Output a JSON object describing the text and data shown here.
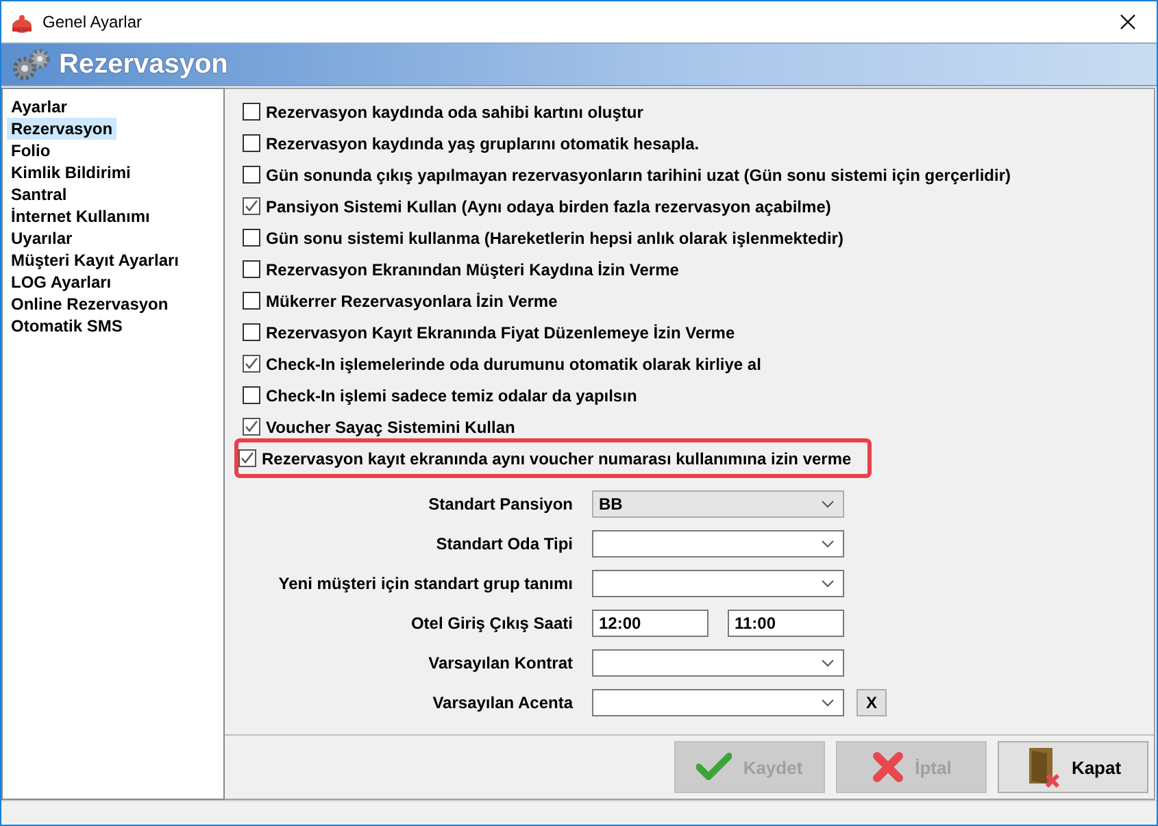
{
  "window": {
    "title": "Genel Ayarlar"
  },
  "header": {
    "title": "Rezervasyon"
  },
  "sidebar": {
    "items": [
      {
        "label": "Ayarlar",
        "selected": false
      },
      {
        "label": "Rezervasyon",
        "selected": true
      },
      {
        "label": "Folio",
        "selected": false
      },
      {
        "label": "Kimlik Bildirimi",
        "selected": false
      },
      {
        "label": "Santral",
        "selected": false
      },
      {
        "label": "İnternet Kullanımı",
        "selected": false
      },
      {
        "label": "Uyarılar",
        "selected": false
      },
      {
        "label": "Müşteri Kayıt Ayarları",
        "selected": false
      },
      {
        "label": "LOG Ayarları",
        "selected": false
      },
      {
        "label": "Online Rezervasyon",
        "selected": false
      },
      {
        "label": "Otomatik SMS",
        "selected": false
      }
    ]
  },
  "options": [
    {
      "label": "Rezervasyon kaydında oda sahibi kartını oluştur",
      "checked": false,
      "highlighted": false
    },
    {
      "label": "Rezervasyon kaydında yaş gruplarını otomatik hesapla.",
      "checked": false,
      "highlighted": false
    },
    {
      "label": "Gün sonunda çıkış yapılmayan rezervasyonların tarihini uzat (Gün sonu sistemi için gerçerlidir)",
      "checked": false,
      "highlighted": false
    },
    {
      "label": "Pansiyon Sistemi Kullan (Aynı odaya birden fazla rezervasyon açabilme)",
      "checked": true,
      "highlighted": false
    },
    {
      "label": "Gün sonu sistemi kullanma (Hareketlerin hepsi anlık olarak işlenmektedir)",
      "checked": false,
      "highlighted": false
    },
    {
      "label": "Rezervasyon Ekranından Müşteri Kaydına İzin Verme",
      "checked": false,
      "highlighted": false
    },
    {
      "label": "Mükerrer Rezervasyonlara İzin Verme",
      "checked": false,
      "highlighted": false
    },
    {
      "label": "Rezervasyon Kayıt Ekranında Fiyat Düzenlemeye İzin Verme",
      "checked": false,
      "highlighted": false
    },
    {
      "label": "Check-In işlemelerinde oda durumunu otomatik olarak kirliye al",
      "checked": true,
      "highlighted": false
    },
    {
      "label": "Check-In işlemi sadece temiz odalar da yapılsın",
      "checked": false,
      "highlighted": false
    },
    {
      "label": "Voucher Sayaç Sistemini Kullan",
      "checked": true,
      "highlighted": false
    },
    {
      "label": "Rezervasyon kayıt ekranında aynı voucher numarası kullanımına izin verme",
      "checked": true,
      "highlighted": true
    }
  ],
  "form": [
    {
      "kind": "select",
      "label": "Standart Pansiyon",
      "value": "BB",
      "disabled": true
    },
    {
      "kind": "select",
      "label": "Standart Oda Tipi",
      "disabled": false
    },
    {
      "kind": "select",
      "label": "Yeni müşteri için standart grup tanımı",
      "disabled": false
    },
    {
      "kind": "pair",
      "label": "Otel Giriş Çıkış Saati",
      "values": [
        "12:00",
        "11:00"
      ]
    },
    {
      "kind": "select",
      "label": "Varsayılan Kontrat",
      "disabled": false
    },
    {
      "kind": "select",
      "label": "Varsayılan Acenta",
      "disabled": false,
      "clear": "X"
    }
  ],
  "buttons": [
    {
      "kind": "save",
      "label": "Kaydet",
      "disabled": true
    },
    {
      "kind": "cancel",
      "label": "İptal",
      "disabled": true
    },
    {
      "kind": "close",
      "label": "Kapat",
      "disabled": false
    }
  ]
}
